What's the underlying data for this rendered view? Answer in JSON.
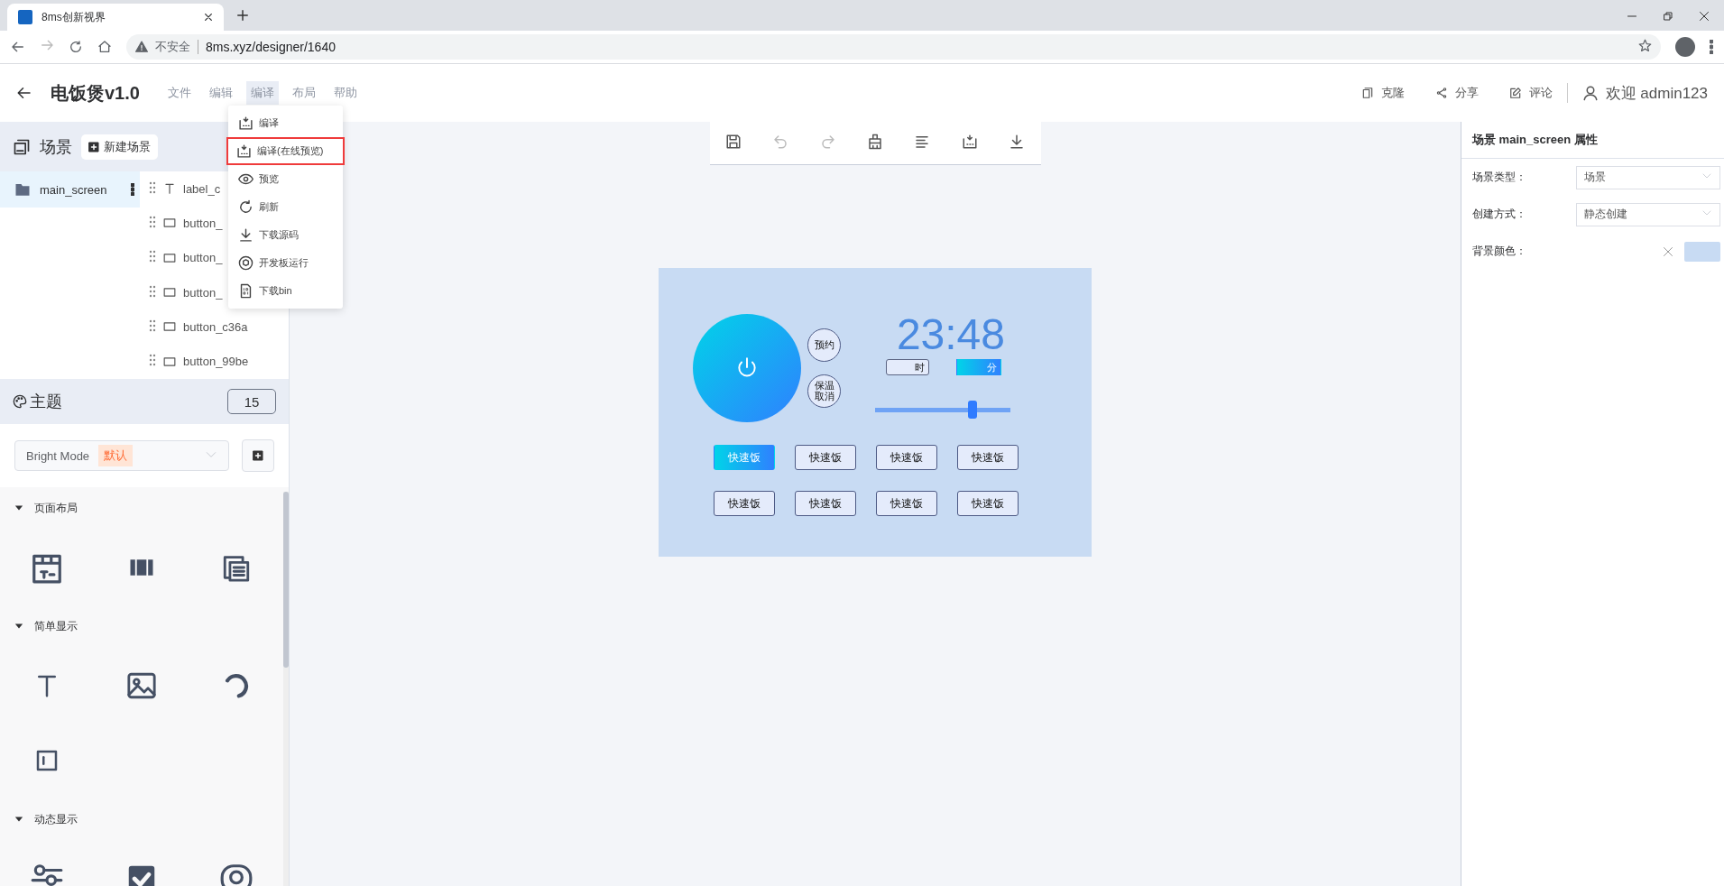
{
  "browser": {
    "tab_title": "8ms创新视界",
    "security": "不安全",
    "url": "8ms.xyz/designer/1640"
  },
  "header": {
    "title": "电饭煲v1.0",
    "menus": [
      {
        "label": "文件",
        "selected": false
      },
      {
        "label": "编辑",
        "selected": false
      },
      {
        "label": "编译",
        "selected": true
      },
      {
        "label": "布局",
        "selected": false
      },
      {
        "label": "帮助",
        "selected": false
      }
    ],
    "actions": [
      {
        "label": "克隆",
        "kind": "clone"
      },
      {
        "label": "分享",
        "kind": "share"
      },
      {
        "label": "评论",
        "kind": "comment"
      }
    ],
    "user": "欢迎 admin123"
  },
  "dropdown": [
    {
      "label": "编译",
      "kind": "compile",
      "selected": false
    },
    {
      "label": "编译(在线预览)",
      "kind": "compile",
      "selected": true
    },
    {
      "label": "预览",
      "kind": "preview",
      "selected": false
    },
    {
      "label": "刷新",
      "kind": "refresh",
      "selected": false
    },
    {
      "label": "下载源码",
      "kind": "download",
      "selected": false
    },
    {
      "label": "开发板运行",
      "kind": "board",
      "selected": false
    },
    {
      "label": "下载bin",
      "kind": "binary",
      "selected": false
    }
  ],
  "scenes": {
    "title": "场景",
    "new_button": "新建场景",
    "items": [
      {
        "label": "main_screen",
        "selected": true,
        "children": [
          {
            "label": "label_c",
            "kind": "label"
          },
          {
            "label": "button_",
            "kind": "button"
          },
          {
            "label": "button_",
            "kind": "button"
          },
          {
            "label": "button_",
            "kind": "button"
          },
          {
            "label": "button_c36a",
            "kind": "button"
          },
          {
            "label": "button_99be",
            "kind": "button"
          }
        ]
      }
    ]
  },
  "theme": {
    "title": "主题",
    "count": "15",
    "mode": "Bright Mode",
    "tag": "默认"
  },
  "palette": [
    {
      "title": "页面布局",
      "expanded": true,
      "items": [
        {
          "kind": "tab"
        },
        {
          "kind": "columns"
        },
        {
          "kind": "pages"
        }
      ]
    },
    {
      "title": "简单显示",
      "expanded": true,
      "items": [
        {
          "kind": "text"
        },
        {
          "kind": "image"
        },
        {
          "kind": "spinner"
        },
        {
          "kind": "textbox"
        }
      ]
    },
    {
      "title": "动态显示",
      "expanded": true,
      "items": [
        {
          "kind": "slider"
        },
        {
          "kind": "checkbox"
        },
        {
          "kind": "toggle"
        }
      ]
    }
  ],
  "device": {
    "reserve": "预约",
    "keep_warm": "保温取消",
    "time": "23:48",
    "time_units": [
      {
        "label": "时",
        "selected": false
      },
      {
        "label": "分",
        "selected": true
      }
    ],
    "slider": {
      "level": 0.72
    },
    "buttons": [
      {
        "label": "快速饭",
        "selected": true
      },
      {
        "label": "快速饭",
        "selected": false
      },
      {
        "label": "快速饭",
        "selected": false
      },
      {
        "label": "快速饭",
        "selected": false
      },
      {
        "label": "快速饭",
        "selected": false
      },
      {
        "label": "快速饭",
        "selected": false
      },
      {
        "label": "快速饭",
        "selected": false
      },
      {
        "label": "快速饭",
        "selected": false
      }
    ]
  },
  "properties": {
    "title": "场景 main_screen 属性",
    "fields": [
      {
        "label": "场景类型：",
        "kind": "select",
        "value": "场景"
      },
      {
        "label": "创建方式：",
        "kind": "select",
        "value": "静态创建"
      },
      {
        "label": "背景颜色：",
        "kind": "color",
        "color": "#c8dbf3"
      }
    ]
  }
}
